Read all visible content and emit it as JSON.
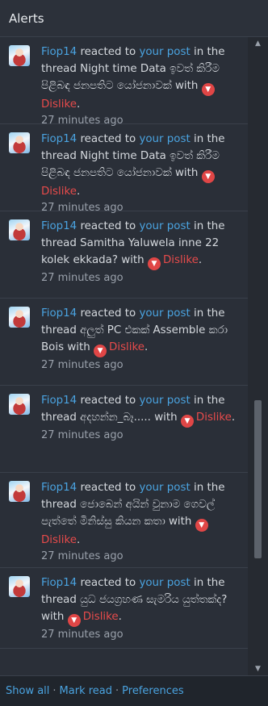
{
  "header": {
    "title": "Alerts"
  },
  "alerts": [
    {
      "user": "Fiop14",
      "reacted": "reacted to",
      "post_link": "your post",
      "in_thread": "in the thread",
      "thread": "Night time Data ඉවත් කිරීම පිළිබඳ ජනපතිට යෝජනාවක්",
      "with": "with",
      "reaction": "Dislike",
      "period": ".",
      "time": "27 minutes ago"
    },
    {
      "user": "Fiop14",
      "reacted": "reacted to",
      "post_link": "your post",
      "in_thread": "in the thread",
      "thread": "Night time Data ඉවත් කිරීම පිළිබඳ ජනපතිට යෝජනාවක්",
      "with": "with",
      "reaction": "Dislike",
      "period": ".",
      "time": "27 minutes ago"
    },
    {
      "user": "Fiop14",
      "reacted": "reacted to",
      "post_link": "your post",
      "in_thread": "in the thread",
      "thread": "Samitha Yaluwela inne 22 kolek ekkada?",
      "with": "with",
      "reaction": "Dislike",
      "period": ".",
      "time": "27 minutes ago"
    },
    {
      "user": "Fiop14",
      "reacted": "reacted to",
      "post_link": "your post",
      "in_thread": "in the thread",
      "thread": "අලුත් PC එකක් Assemble කරා Bois",
      "with": "with",
      "reaction": "Dislike",
      "period": ".",
      "time": "27 minutes ago"
    },
    {
      "user": "Fiop14",
      "reacted": "reacted to",
      "post_link": "your post",
      "in_thread": "in the thread",
      "thread": "අදහන්න_බෑ.....",
      "with": "with",
      "reaction": "Dislike",
      "period": ".",
      "time": "27 minutes ago"
    },
    {
      "user": "Fiop14",
      "reacted": "reacted to",
      "post_link": "your post",
      "in_thread": "in the thread",
      "thread": "ජොබෙන් අයින් වුනාම ගෙවල් පැත්තේ මිනිස්සු කියන කතා",
      "with": "with",
      "reaction": "Dislike",
      "period": ".",
      "time": "27 minutes ago"
    },
    {
      "user": "Fiop14",
      "reacted": "reacted to",
      "post_link": "your post",
      "in_thread": "in the thread",
      "thread": "යුධ ජයග්‍රහණ සැමරිය යුත්තක්ද?",
      "with": "with",
      "reaction": "Dislike",
      "period": ".",
      "time": "27 minutes ago"
    }
  ],
  "footer": {
    "show_all": "Show all",
    "mark_read": "Mark read",
    "preferences": "Preferences",
    "separator": "·"
  },
  "colors": {
    "background": "#2a2f38",
    "link": "#4aa3e0",
    "dislike": "#e84b4b",
    "muted": "#9aa1ab"
  },
  "icons": {
    "dislike": "thumbs-down-icon",
    "scroll_up": "scroll-up-arrow-icon",
    "scroll_down": "scroll-down-arrow-icon"
  }
}
